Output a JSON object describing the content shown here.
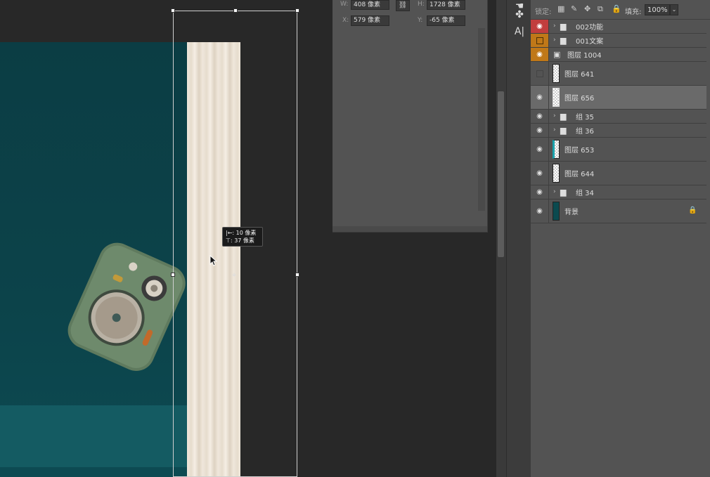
{
  "properties": {
    "w_label": "W:",
    "w_value": "408 像素",
    "h_label": "H:",
    "h_value": "1728 像素",
    "x_label": "X:",
    "x_value": "579 像素",
    "y_label": "Y:",
    "y_value": "-65 像素"
  },
  "tooltip": {
    "line1": "|←: 10 像素",
    "line2": "⊤: 37 像素"
  },
  "layers_panel": {
    "lock_label": "锁定:",
    "fill_label": "填充:",
    "fill_value": "100%",
    "layers": [
      {
        "name": "002功能",
        "kind": "group",
        "visibility": "red"
      },
      {
        "name": "001文案",
        "kind": "group",
        "visibility": "orange-hidden"
      },
      {
        "name": "图层 1004",
        "kind": "smart",
        "visibility": "orange"
      },
      {
        "name": "图层 641",
        "kind": "layer",
        "visibility": "hidden"
      },
      {
        "name": "图层 656",
        "kind": "layer",
        "visibility": "visible",
        "selected": true
      },
      {
        "name": "组 35",
        "kind": "group",
        "visibility": "visible"
      },
      {
        "name": "组 36",
        "kind": "group",
        "visibility": "visible"
      },
      {
        "name": "图层 653",
        "kind": "layer",
        "visibility": "visible"
      },
      {
        "name": "图层 644",
        "kind": "layer",
        "visibility": "visible"
      },
      {
        "name": "组 34",
        "kind": "group",
        "visibility": "visible"
      },
      {
        "name": "背景",
        "kind": "background",
        "visibility": "visible",
        "locked": true
      }
    ]
  },
  "colors": {
    "canvas_teal": "#0b3d44",
    "eye_red": "#c13d3d",
    "eye_orange": "#c07818",
    "panel_bg": "#535353"
  }
}
